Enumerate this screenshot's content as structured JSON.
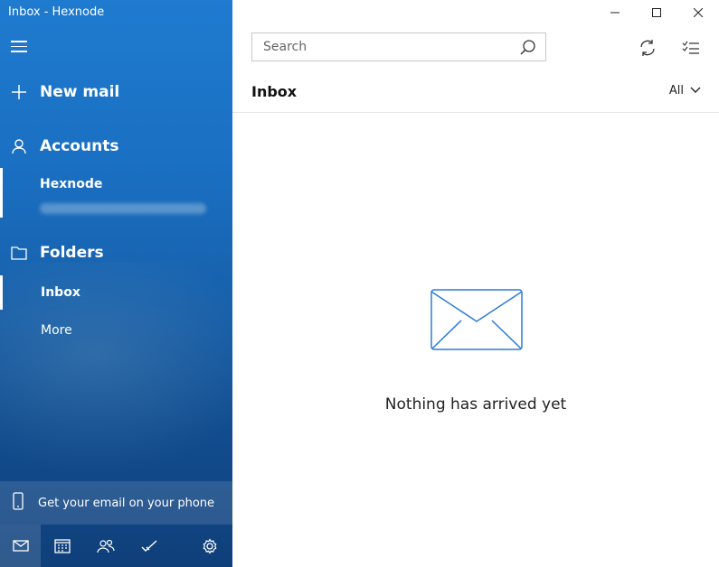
{
  "window": {
    "title": "Inbox - Hexnode"
  },
  "sidebar": {
    "new_mail": "New mail",
    "accounts": "Accounts",
    "account_name": "Hexnode",
    "folders": "Folders",
    "folder_items": [
      "Inbox",
      "More"
    ],
    "phone_promo": "Get your email on your phone"
  },
  "search": {
    "placeholder": "Search"
  },
  "list": {
    "title": "Inbox",
    "filter": "All",
    "empty_message": "Nothing has arrived yet"
  },
  "colors": {
    "accent": "#1a6fc2",
    "icon_blue": "#2b7bd3"
  },
  "icons": {
    "bottom_nav": [
      "mail-icon",
      "calendar-icon",
      "people-icon",
      "todo-icon",
      "settings-icon"
    ],
    "toolbar": [
      "sync-icon",
      "select-icon"
    ]
  }
}
